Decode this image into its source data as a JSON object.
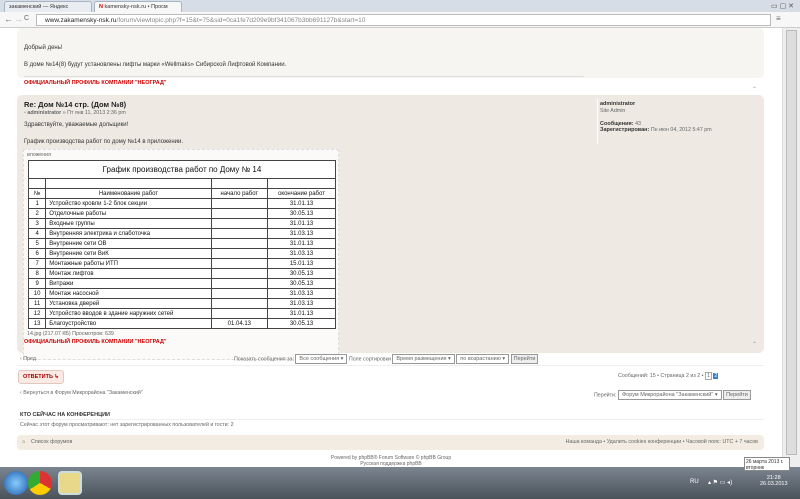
{
  "browser": {
    "tabs": [
      "закаменский — Яндекс",
      "kamensky-nsk.ru • Просм"
    ],
    "url_host": "www.zakamensky-nsk.ru",
    "url_path": "/forum/viewtopic.php?f=15&t=75&sid=0ca1fe7d209e9bf341067b3bb691127b&start=10"
  },
  "post1": {
    "greeting": "Добрый день!",
    "text": "В доме №14(8) будут установлены лифты марки «Wellmaks» Сибирской Лифтовой Компании.",
    "signature": "ОФИЦИАЛЬНЫЙ ПРОФИЛЬ КОМПАНИИ \"НЕОГРАД\""
  },
  "post2": {
    "title": "Re: Дом №14 стр. (Дом №8)",
    "author": "administrator",
    "date": "» Пт янв 11, 2013 2:36 pm",
    "greeting": "Здравствуйте, уважаемые дольщики!",
    "text": "График производства работ по дому №14 в приложении.",
    "attachments_label": "вложения",
    "file_info": "14.jpg (217.07 КБ) Просмотров: 639",
    "signature": "ОФИЦИАЛЬНЫЙ ПРОФИЛЬ КОМПАНИИ \"НЕОГРАД\"",
    "profile": {
      "name": "administrator",
      "rank": "Site Admin",
      "posts_label": "Сообщения:",
      "posts": "43",
      "reg_label": "Зарегистрирован:",
      "reg": "Пн июн 04, 2012 5:47 pm"
    }
  },
  "schedule": {
    "title": "График производства работ по Дому № 14",
    "headers": [
      "№",
      "Наименование работ",
      "начало работ",
      "окончание работ"
    ],
    "rows": [
      [
        "1",
        "Устройство кровли 1-2  блок секции",
        "",
        "31.01.13"
      ],
      [
        "2",
        "Отделочные работы",
        "",
        "30.05.13"
      ],
      [
        "3",
        "Входные группы",
        "",
        "31.01.13"
      ],
      [
        "4",
        "Внутренняя электрика и слаботочка",
        "",
        "31.03.13"
      ],
      [
        "5",
        "Внутренние сети ОВ",
        "",
        "31.01.13"
      ],
      [
        "6",
        "Внутренние сети ВиК",
        "",
        "31.03.13"
      ],
      [
        "7",
        "Монтажные работы ИТП",
        "",
        "15.01.13"
      ],
      [
        "8",
        "Монтаж лифтов",
        "",
        "30.05.13"
      ],
      [
        "9",
        "Витражи",
        "",
        "30.05.13"
      ],
      [
        "10",
        "Монтаж насосной",
        "",
        "31.03.13"
      ],
      [
        "11",
        "Установка дверей",
        "",
        "31.03.13"
      ],
      [
        "12",
        "Устройство вводов в здание наружних сетей",
        "",
        "31.01.13"
      ],
      [
        "13",
        "Благоустройство",
        "01.04.13",
        "30.05.13"
      ]
    ]
  },
  "controls": {
    "prev": "‹ Пред.",
    "show_label": "Показать сообщения за:",
    "show_value": "Все сообщения",
    "sort_label": "Поле сортировки",
    "sort_value": "Время размещения",
    "order_value": "по возрастанию",
    "go": "Перейти",
    "reply": "ОТВЕТИТЬ ↳",
    "pagination": "Сообщений: 15 • Страница 2 из 2 •",
    "pages": [
      "1",
      "2"
    ],
    "back": "‹ Вернуться в Форум Микрорайона \"Закаменский\"",
    "jump_label": "Перейти:",
    "jump_value": "Форум Микрорайона \"Закаменский\""
  },
  "online": {
    "title": "КТО СЕЙЧАС НА КОНФЕРЕНЦИИ",
    "text": "Сейчас этот форум просматривают: нет зарегистрированных пользователей и гости: 2"
  },
  "footer": {
    "index": "Список форумов",
    "links": "Наша команда • Удалить cookies конференции • Часовой пояс: UTC + 7 часов",
    "powered": "Powered by phpBB® Forum Software © phpBB Group",
    "support": "Русская поддержка phpBB"
  },
  "taskbar": {
    "lang": "RU",
    "time": "21:28",
    "date": "26.03.2013",
    "tooltip1": "26 марта 2013 г.",
    "tooltip2": "вторник"
  }
}
